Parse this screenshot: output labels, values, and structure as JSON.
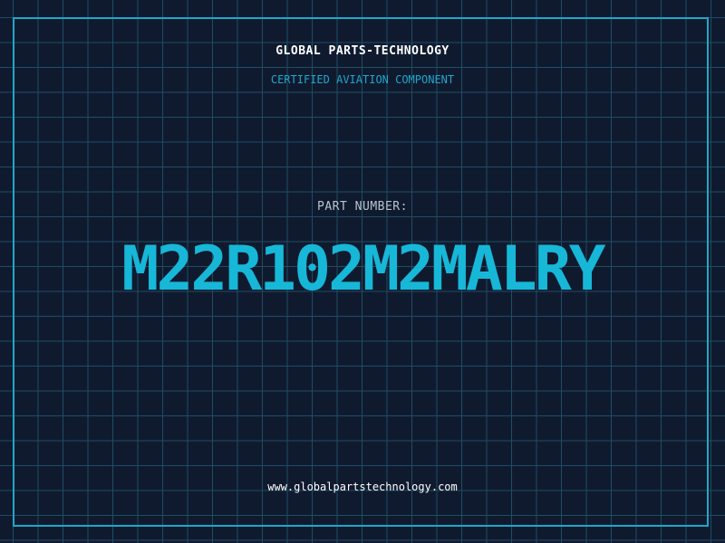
{
  "header": {
    "brand": "GLOBAL PARTS-TECHNOLOGY",
    "tagline": "CERTIFIED AVIATION COMPONENT"
  },
  "main": {
    "label": "PART NUMBER:",
    "part_number": "M22R102M2MALRY"
  },
  "footer": {
    "url": "www.globalpartstechnology.com"
  },
  "colors": {
    "background": "#101a2f",
    "grid": "#1c4e63",
    "accent": "#1fa7c9",
    "part_number": "#17b7d8"
  }
}
